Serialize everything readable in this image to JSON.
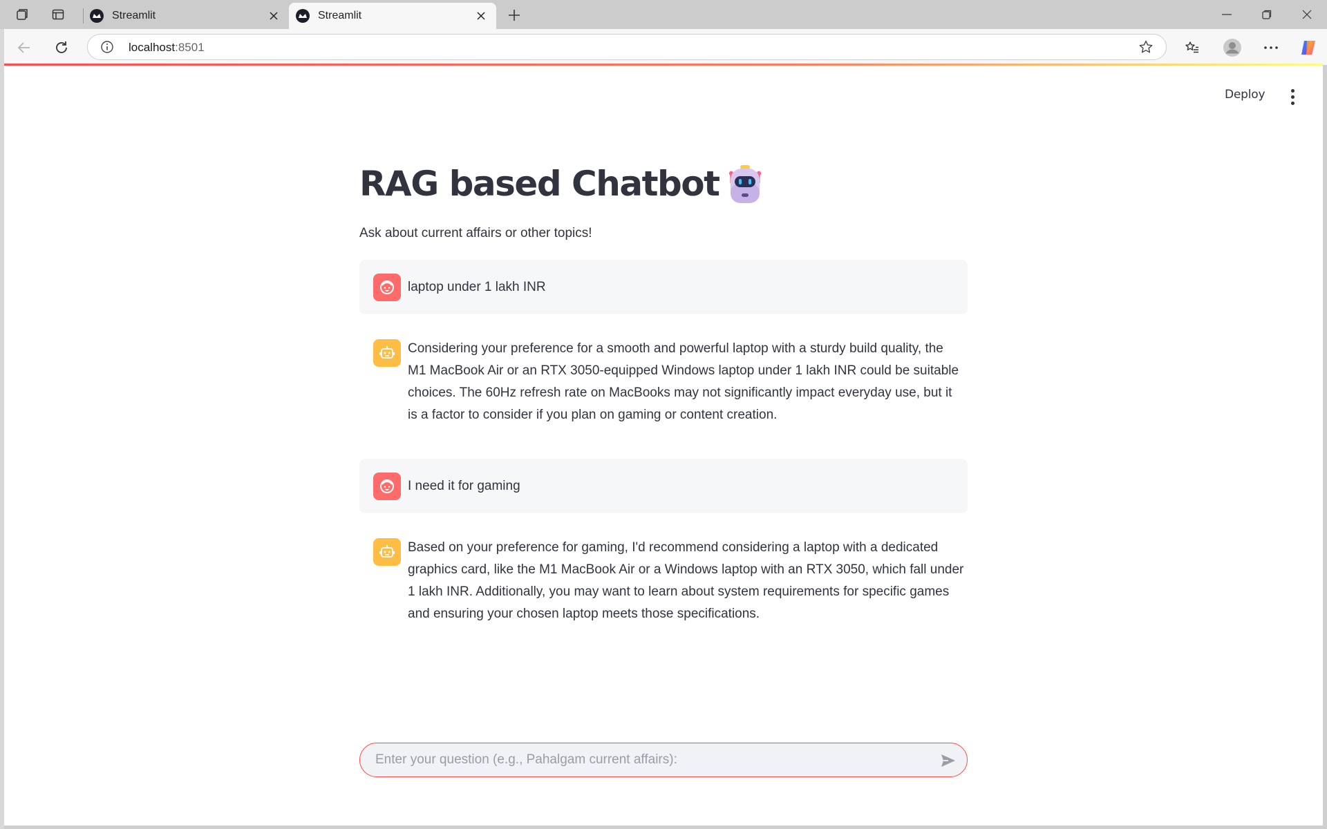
{
  "browser": {
    "tabs": [
      {
        "title": "Streamlit",
        "active": false
      },
      {
        "title": "Streamlit",
        "active": true
      }
    ],
    "address": {
      "host": "localhost",
      "port": ":8501"
    }
  },
  "header": {
    "deploy_label": "Deploy"
  },
  "main": {
    "title": "RAG based Chatbot",
    "title_emoji": "robot",
    "subtitle": "Ask about current affairs or other topics!"
  },
  "messages": [
    {
      "role": "user",
      "text": "laptop under 1 lakh INR"
    },
    {
      "role": "assistant",
      "text": "Considering your preference for a smooth and powerful laptop with a sturdy build quality, the M1 MacBook Air or an RTX 3050-equipped Windows laptop under 1 lakh INR could be suitable choices. The 60Hz refresh rate on MacBooks may not significantly impact everyday use, but it is a factor to consider if you plan on gaming or content creation."
    },
    {
      "role": "user",
      "text": "I need it for gaming"
    },
    {
      "role": "assistant",
      "text": "Based on your preference for gaming, I'd recommend considering a laptop with a dedicated graphics card, like the M1 MacBook Air or a Windows laptop with an RTX 3050, which fall under 1 lakh INR. Additionally, you may want to learn about system requirements for specific games and ensuring your chosen laptop meets those specifications."
    }
  ],
  "chat_input": {
    "placeholder": "Enter your question (e.g., Pahalgam current affairs):"
  },
  "colors": {
    "accent": "#ff4b4b",
    "user_avatar": "#ff6a6a",
    "assistant_avatar": "#ffbd45",
    "text": "#31333f"
  }
}
